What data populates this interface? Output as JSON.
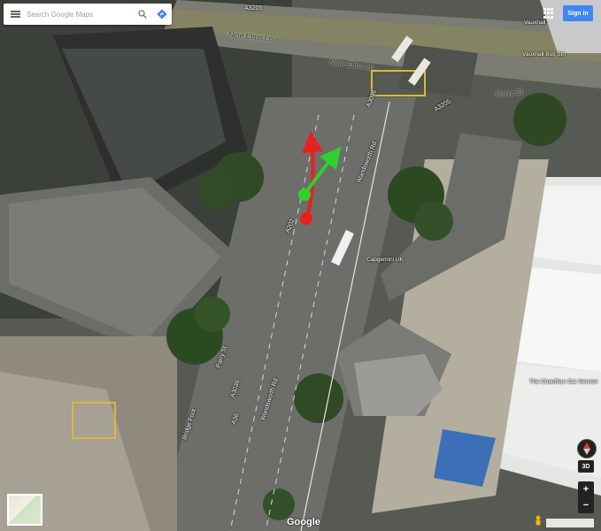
{
  "search": {
    "placeholder": "Search Google Maps",
    "menu_icon": "hamburger-menu-icon",
    "search_icon": "search-icon",
    "directions_icon": "directions-icon"
  },
  "header": {
    "signin_label": "Sign in",
    "apps_icon": "apps-grid-icon"
  },
  "road_labels": {
    "nine_elms_upper": "Nine Elms Ln",
    "nine_elms_lower": "Nine Elms Ln",
    "parry_st_right": "Parry St",
    "a3205": "A3205",
    "a3036": "A3036",
    "a3205_right": "A3205",
    "wandsworth_rd": "Wandsworth Rd",
    "wandsworth_rd_lower": "Wandsworth Rd",
    "parry_st_lower": "Parry St",
    "a3036_lower": "A3036",
    "a202": "A202",
    "bridge_foot": "Bridge Foot",
    "a36": "A36"
  },
  "poi_labels": {
    "vauxhall": "Vauxhall",
    "vauxhall_bus": "Vauxhall Bus Stn",
    "capgemini": "Capgemini UK",
    "chauffeur": "The Chauffeur Car Service"
  },
  "controls": {
    "btn_3d": "3D",
    "zoom_in": "+",
    "zoom_out": "−",
    "compass_icon": "compass-icon",
    "pegman_icon": "pegman-icon",
    "google_logo": "Google"
  },
  "annotations": {
    "red_arrow_color": "#e8201e",
    "green_arrow_color": "#2ed12e"
  }
}
